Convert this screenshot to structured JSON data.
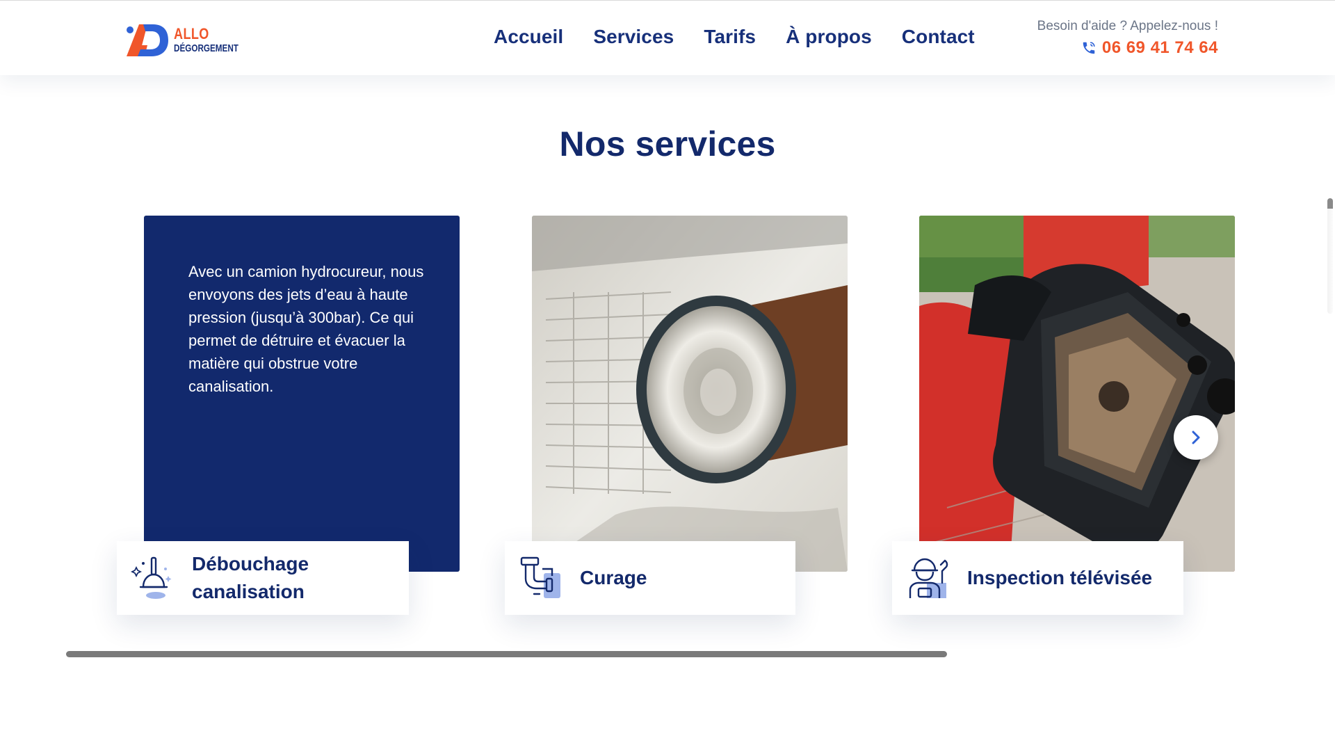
{
  "header": {
    "logo": {
      "line1": "ALLO",
      "line2": "DÉGORGEMENT"
    },
    "nav": [
      {
        "label": "Accueil"
      },
      {
        "label": "Services"
      },
      {
        "label": "Tarifs"
      },
      {
        "label": "À propos"
      },
      {
        "label": "Contact"
      }
    ],
    "help_text": "Besoin d'aide ? Appelez-nous !",
    "phone": "06 69 41 74 64"
  },
  "services": {
    "title": "Nos services",
    "cards": [
      {
        "label": "Débouchage canalisation",
        "description": "Avec un camion hydrocureur, nous envoyons des jets d’eau à haute pression (jusqu’à 300bar). Ce qui permet de détruire et évacuer la matière qui obstrue votre canalisation.",
        "icon": "plunger-icon"
      },
      {
        "label": "Curage",
        "icon": "pipe-icon"
      },
      {
        "label": "Inspection télévisée",
        "icon": "technician-icon"
      }
    ]
  },
  "colors": {
    "navy": "#13296b",
    "accent": "#f0562a",
    "card_blue": "#12296d",
    "icon_light_blue": "#9fb4ea"
  }
}
